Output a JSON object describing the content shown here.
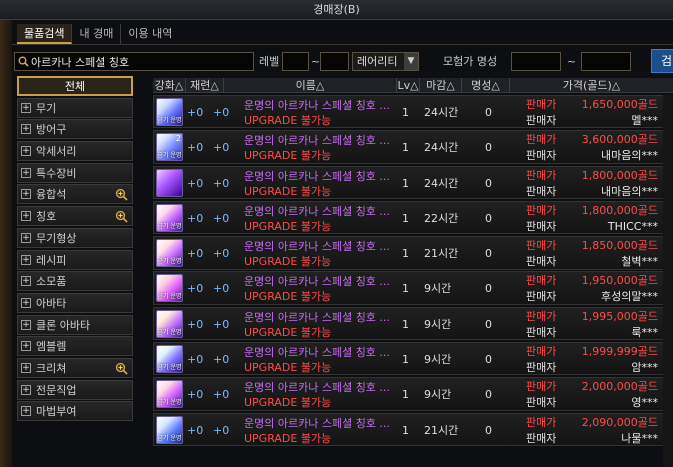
{
  "window": {
    "title": "경매장(B)"
  },
  "tabs": [
    {
      "label": "물품검색"
    },
    {
      "label": "내 경매"
    },
    {
      "label": "이용 내역"
    }
  ],
  "search": {
    "value": "아르카나 스페셜 칭호",
    "icon": "search-icon"
  },
  "filters": {
    "level_label": "레벨",
    "level_min": "",
    "level_sep": "~",
    "level_max": "",
    "rarity_value": "레어리티",
    "fame_label": "모험가 명성",
    "fame_min": "",
    "fame_sep": "~",
    "fame_max": "",
    "search_button": "검"
  },
  "categories": [
    {
      "label": "전체",
      "active": true
    },
    {
      "label": "무기"
    },
    {
      "label": "방어구"
    },
    {
      "label": "악세서리"
    },
    {
      "label": "특수장비"
    },
    {
      "label": "융합석",
      "mag": true
    },
    {
      "label": "칭호",
      "mag": true
    },
    {
      "label": "무기형상"
    },
    {
      "label": "레시피"
    },
    {
      "label": "소모품"
    },
    {
      "label": "아바타"
    },
    {
      "label": "클론 아바타"
    },
    {
      "label": "엠블렘"
    },
    {
      "label": "크리쳐",
      "mag": true
    },
    {
      "label": "전문직업"
    },
    {
      "label": "마법부여"
    }
  ],
  "columns": {
    "enhance": "강화△",
    "refine": "재련△",
    "name": "이름△",
    "lv": "Lv△",
    "deadline": "마감△",
    "fame": "명성△",
    "price": "가격(골드)△"
  },
  "colors": {
    "name": "#c56cf0",
    "upgrade": "#ff4a4a",
    "price": "#ff4a4a",
    "accent": "#c8a04a"
  },
  "listings": [
    {
      "enh": "+0",
      "ref": "+0",
      "name": "운명의 아르카나 스페셜 칭호 ...",
      "upgrade": "UPGRADE 불가능",
      "lv": "1",
      "deadline": "24시간",
      "fame": "0",
      "sale_label": "판매가",
      "seller_label": "판매자",
      "price": "1,650,000골드",
      "seller": "멜***",
      "icon_caption": "금기 운명",
      "stack": ""
    },
    {
      "enh": "+0",
      "ref": "+0",
      "name": "운명의 아르카나 스페셜 칭호 ...",
      "upgrade": "UPGRADE 불가능",
      "lv": "1",
      "deadline": "24시간",
      "fame": "0",
      "sale_label": "판매가",
      "seller_label": "판매자",
      "price": "3,600,000골드",
      "seller": "내마음의***",
      "icon_caption": "금기 운명",
      "stack": "2"
    },
    {
      "enh": "+0",
      "ref": "+0",
      "name": "운명의 아르카나 스페셜 칭호 ...",
      "upgrade": "UPGRADE 불가능",
      "lv": "1",
      "deadline": "24시간",
      "fame": "0",
      "sale_label": "판매가",
      "seller_label": "판매자",
      "price": "1,800,000골드",
      "seller": "내마음의***",
      "icon_caption": "",
      "stack": ""
    },
    {
      "enh": "+0",
      "ref": "+0",
      "name": "운명의 아르카나 스페셜 칭호 ...",
      "upgrade": "UPGRADE 불가능",
      "lv": "1",
      "deadline": "22시간",
      "fame": "0",
      "sale_label": "판매가",
      "seller_label": "판매자",
      "price": "1,800,000골드",
      "seller": "THICC***",
      "icon_caption": "금기 운명",
      "stack": ""
    },
    {
      "enh": "+0",
      "ref": "+0",
      "name": "운명의 아르카나 스페셜 칭호 ...",
      "upgrade": "UPGRADE 불가능",
      "lv": "1",
      "deadline": "21시간",
      "fame": "0",
      "sale_label": "판매가",
      "seller_label": "판매자",
      "price": "1,850,000골드",
      "seller": "철벽***",
      "icon_caption": "금기 운명",
      "stack": ""
    },
    {
      "enh": "+0",
      "ref": "+0",
      "name": "운명의 아르카나 스페셜 칭호 ...",
      "upgrade": "UPGRADE 불가능",
      "lv": "1",
      "deadline": "9시간",
      "fame": "0",
      "sale_label": "판매가",
      "seller_label": "판매자",
      "price": "1,950,000골드",
      "seller": "후성의말***",
      "icon_caption": "금기 운명",
      "stack": ""
    },
    {
      "enh": "+0",
      "ref": "+0",
      "name": "운명의 아르카나 스페셜 칭호 ...",
      "upgrade": "UPGRADE 불가능",
      "lv": "1",
      "deadline": "9시간",
      "fame": "0",
      "sale_label": "판매가",
      "seller_label": "판매자",
      "price": "1,995,000골드",
      "seller": "룩***",
      "icon_caption": "금기 운명",
      "stack": ""
    },
    {
      "enh": "+0",
      "ref": "+0",
      "name": "운명의 아르카나 스페셜 칭호 ...",
      "upgrade": "UPGRADE 불가능",
      "lv": "1",
      "deadline": "9시간",
      "fame": "0",
      "sale_label": "판매가",
      "seller_label": "판매자",
      "price": "1,999,999골드",
      "seller": "암***",
      "icon_caption": "금기 운명",
      "stack": ""
    },
    {
      "enh": "+0",
      "ref": "+0",
      "name": "운명의 아르카나 스페셜 칭호 ...",
      "upgrade": "UPGRADE 불가능",
      "lv": "1",
      "deadline": "9시간",
      "fame": "0",
      "sale_label": "판매가",
      "seller_label": "판매자",
      "price": "2,000,000골드",
      "seller": "영***",
      "icon_caption": "금기 운명",
      "stack": ""
    },
    {
      "enh": "+0",
      "ref": "+0",
      "name": "운명의 아르카나 스페셜 칭호 ...",
      "upgrade": "UPGRADE 불가능",
      "lv": "1",
      "deadline": "21시간",
      "fame": "0",
      "sale_label": "판매가",
      "seller_label": "판매자",
      "price": "2,090,000골드",
      "seller": "나물***",
      "icon_caption": "금기 운명",
      "stack": ""
    }
  ]
}
